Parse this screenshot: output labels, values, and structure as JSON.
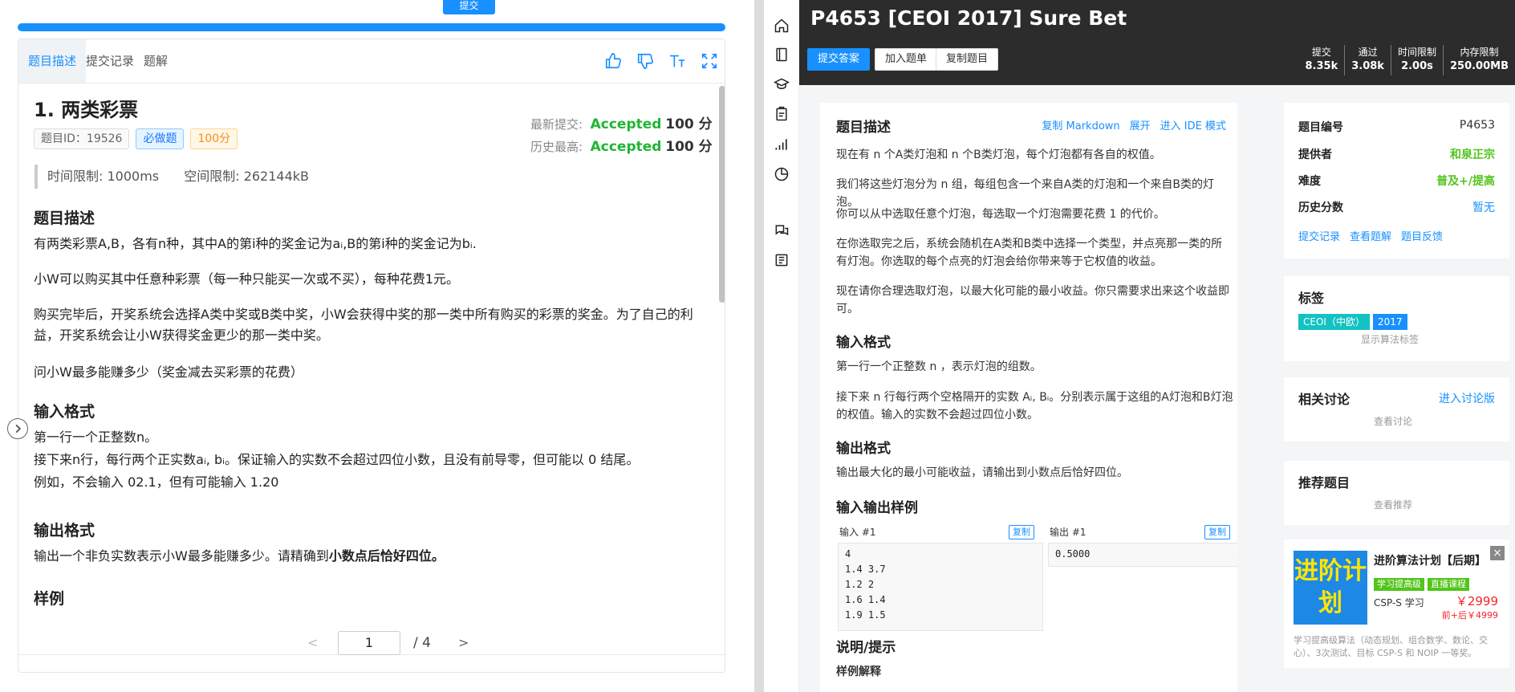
{
  "left": {
    "top_button": "提交",
    "tabs": [
      "题目描述",
      "提交记录",
      "题解"
    ],
    "title": "1.  两类彩票",
    "badges": {
      "id": "题目ID：19526",
      "required": "必做题",
      "score": "100分"
    },
    "latest_label": "最新提交:",
    "history_label": "历史最高:",
    "accepted": "Accepted",
    "score_text": "100 分",
    "time_limit": "时间限制: 1000ms",
    "space_limit": "空间限制: 262144kB",
    "sections": {
      "desc": "题目描述",
      "input": "输入格式",
      "output": "输出格式",
      "sample": "样例"
    },
    "paras": {
      "p1": "有两类彩票A,B，各有n种，其中A的第i种的奖金记为aᵢ,B的第i种的奖金记为bᵢ.",
      "p2": "小W可以购买其中任意种彩票（每一种只能买一次或不买），每种花费1元。",
      "p3": "购买完毕后，开奖系统会选择A类中奖或B类中奖，小W会获得中奖的那一类中所有购买的彩票的奖金。为了自己的利益，开奖系统会让小W获得奖金更少的那一类中奖。",
      "p4": "问小W最多能赚多少（奖金减去买彩票的花费）",
      "p5": "第一行一个正整数n。",
      "p6": "接下来n行，每行两个正实数aᵢ, bᵢ。保证输入的实数不会超过四位小数，且没有前导零，但可能以 0 结尾。",
      "p7": "例如，不会输入 02.1，但有可能输入 1.20",
      "p8a": "输出一个非负实数表示小W最多能赚多少。请精确到",
      "p8b": "小数点后恰好四位。"
    },
    "pager": {
      "prev": "<",
      "current": "1",
      "total": "/  4",
      "next": ">"
    }
  },
  "right": {
    "title": "P4653 [CEOI 2017] Sure Bet",
    "buttons": {
      "submit": "提交答案",
      "add": "加入题单",
      "copy": "复制题目"
    },
    "stats": [
      {
        "label": "提交",
        "value": "8.35k"
      },
      {
        "label": "通过",
        "value": "3.08k"
      },
      {
        "label": "时间限制",
        "value": "2.00s"
      },
      {
        "label": "内存限制",
        "value": "250.00MB"
      }
    ],
    "main": {
      "title": "题目描述",
      "links": [
        "复制 Markdown",
        "展开",
        "进入 IDE 模式"
      ],
      "p1": "现在有 n 个A类灯泡和 n 个B类灯泡，每个灯泡都有各自的权值。",
      "p2": "我们将这些灯泡分为 n 组，每组包含一个来自A类的灯泡和一个来自B类的灯泡。",
      "p3": "你可以从中选取任意个灯泡，每选取一个灯泡需要花费 1 的代价。",
      "p4": "在你选取完之后，系统会随机在A类和B类中选择一个类型，并点亮那一类的所有灯泡。你选取的每个点亮的灯泡会给你带来等于它权值的收益。",
      "p5": "现在请你合理选取灯泡，以最大化可能的最小收益。你只需要求出来这个收益即可。",
      "input_title": "输入格式",
      "p6": "第一行一个正整数 n ，表示灯泡的组数。",
      "p7": "接下来 n 行每行两个空格隔开的实数 Aᵢ, Bᵢ。分别表示属于这组的A灯泡和B灯泡的权值。输入的实数不会超过四位小数。",
      "output_title": "输出格式",
      "p8": "输出最大化的最小可能收益，请输出到小数点后恰好四位。",
      "sample_title": "输入输出样例",
      "in_label": "输入 #1",
      "out_label": "输出 #1",
      "copy": "复制",
      "in_data": "4\n1.4 3.7\n1.2 2\n1.6 1.4\n1.9 1.5",
      "out_data": "0.5000",
      "note_title": "说明/提示",
      "sample_explain": "样例解释"
    },
    "info": {
      "id_label": "题目编号",
      "id": "P4653",
      "provider_label": "提供者",
      "provider": "和泉正宗",
      "difficulty_label": "难度",
      "difficulty": "普及+/提高",
      "history_label": "历史分数",
      "history": "暂无",
      "links": [
        "提交记录",
        "查看题解",
        "题目反馈"
      ]
    },
    "tags_card": {
      "title": "标签",
      "tags": [
        "CEOI（中欧）",
        "2017"
      ],
      "show": "显示算法标签"
    },
    "discuss": {
      "title": "相关讨论",
      "link": "进入讨论版",
      "view": "查看讨论"
    },
    "recommend": {
      "title": "推荐题目",
      "view": "查看推荐"
    },
    "ad": {
      "img_text": "进阶计划",
      "title": "进阶算法计划【后期】",
      "tags": [
        "学习提高级",
        "直播课程"
      ],
      "course": "CSP-S 学习",
      "price": "￥2999",
      "price2": "前+后￥4999",
      "desc": "学习提高级算法（动态规划、组合数学、数论、交心）、3次测试、目标 CSP-S 和 NOIP 一等奖。",
      "close": "×"
    },
    "colors": {
      "accent": "#1890ff",
      "green": "#52c41a",
      "teal": "#13c2c2",
      "header": "#2c2c2c"
    }
  }
}
